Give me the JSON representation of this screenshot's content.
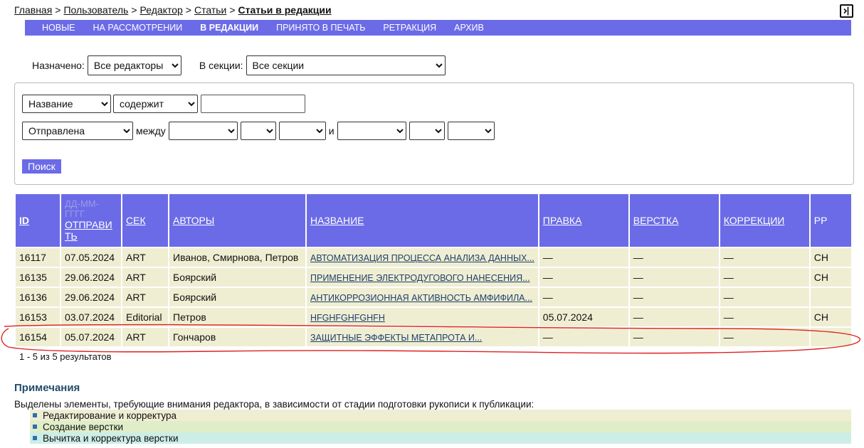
{
  "breadcrumb": {
    "items": [
      "Главная",
      "Пользователь",
      "Редактор",
      "Статьи"
    ],
    "separator": ">",
    "current": "Статьи в редакции"
  },
  "nav": {
    "items": [
      "НОВЫЕ",
      "НА РАССМОТРЕНИИ",
      "В РЕДАКЦИИ",
      "ПРИНЯТО В ПЕЧАТЬ",
      "РЕТРАКЦИЯ",
      "АРХИВ"
    ],
    "active_index": 2
  },
  "filters": {
    "assigned_label": "Назначено:",
    "assigned_value": "Все редакторы",
    "section_label": "В секции:",
    "section_value": "Все секции"
  },
  "search": {
    "field1_value": "Название",
    "op_value": "содержит",
    "query_value": "",
    "date_field_value": "Отправлена",
    "between_label": "между",
    "and_label": "и",
    "button_label": "Поиск"
  },
  "table": {
    "headers": {
      "id": "ID",
      "date_format": "ДД-ММ-ГГГГ",
      "submitted": "ОТПРАВИТЬ",
      "section": "СЕК",
      "authors": "АВТОРЫ",
      "title": "НАЗВАНИЕ",
      "editing": "ПРАВКА",
      "layout": "ВЕРСТКА",
      "proof": "КОРРЕКЦИИ",
      "pp": "РР"
    },
    "rows": [
      {
        "id": "16117",
        "date": "07.05.2024",
        "sec": "ART",
        "authors": "Иванов, Смирнова, Петров",
        "title": "АВТОМАТИЗАЦИЯ ПРОЦЕССА АНАЛИЗА ДАННЫХ...",
        "editing": "—",
        "layout": "—",
        "proof": "—",
        "pp": "СН"
      },
      {
        "id": "16135",
        "date": "29.06.2024",
        "sec": "ART",
        "authors": "Боярский",
        "title": "ПРИМЕНЕНИЕ ЭЛЕКТРОДУГОВОГО НАНЕСЕНИЯ...",
        "editing": "—",
        "layout": "—",
        "proof": "—",
        "pp": "СН"
      },
      {
        "id": "16136",
        "date": "29.06.2024",
        "sec": "ART",
        "authors": "Боярский",
        "title": "АНТИКОРРОЗИОННАЯ АКТИВНОСТЬ АМФИФИЛА...",
        "editing": "—",
        "layout": "—",
        "proof": "—",
        "pp": ""
      },
      {
        "id": "16153",
        "date": "03.07.2024",
        "sec": "Editorial",
        "authors": "Петров",
        "title": "HFGHFGHFGHFH",
        "editing": "05.07.2024",
        "layout": "—",
        "proof": "—",
        "pp": "СН"
      },
      {
        "id": "16154",
        "date": "05.07.2024",
        "sec": "ART",
        "authors": "Гончаров",
        "title": "ЗАЩИТНЫЕ ЭФФЕКТЫ МЕТАПРОТА И...",
        "editing": "—",
        "layout": "—",
        "proof": "—",
        "pp": ""
      }
    ]
  },
  "count_text": "1 - 5 из 5 результатов",
  "notes": {
    "title": "Примечания",
    "description": "Выделены элементы, требующие внимания редактора, в зависимости от стадии подготовки рукописи к публикации:",
    "items": [
      "Редактирование и корректура",
      "Создание верстки",
      "Вычитка и корректура верстки"
    ]
  },
  "colors": {
    "accent": "#6b6be8",
    "row_bg": "#efeed3",
    "legend_editing": "#efeed3",
    "legend_layout": "#dfeec8",
    "legend_proof": "#cdeee6",
    "annotation": "#e02020"
  },
  "icons": {
    "collapse": "sidebar-toggle-icon",
    "dropdown": "chevron-down-icon",
    "bullet": "square-bullet-icon"
  }
}
